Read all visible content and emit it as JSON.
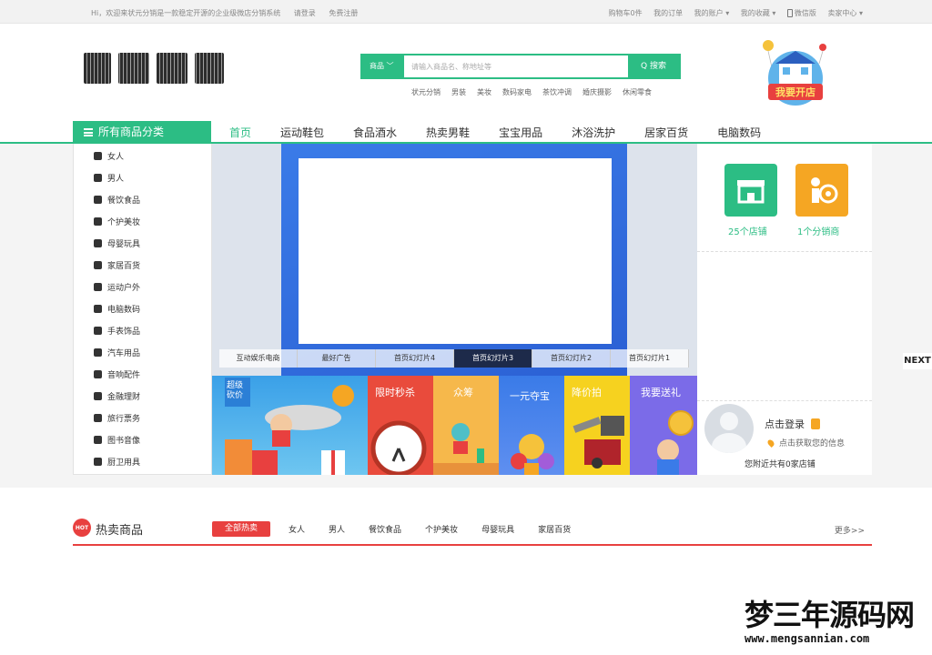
{
  "topbar": {
    "welcome": "Hi，欢迎来状元分销是一款稳定开源的企业级微店分销系统",
    "login": "请登录",
    "register": "免费注册",
    "cart": "购物车0件",
    "orders": "我的订单",
    "account": "我的账户 ▾",
    "favorites": "我的收藏 ▾",
    "wechat": "微信版",
    "seller": "卖家中心 ▾"
  },
  "search": {
    "category": "商品 ﹀",
    "placeholder": "请输入商品名、称地址等",
    "button": "Q 搜索",
    "hotwords": [
      "状元分销",
      "男装",
      "美妆",
      "数码家电",
      "茶饮冲调",
      "婚庆摄影",
      "休闲零食"
    ]
  },
  "badge": {
    "text": "我要开店"
  },
  "nav": {
    "all_categories": "所有商品分类",
    "items": [
      "首页",
      "运动鞋包",
      "食品酒水",
      "热卖男鞋",
      "宝宝用品",
      "沐浴洗护",
      "居家百货",
      "电脑数码"
    ]
  },
  "sidebar": {
    "items": [
      "女人",
      "男人",
      "餐饮食品",
      "个护美妆",
      "母婴玩具",
      "家居百货",
      "运动户外",
      "电脑数码",
      "手表饰品",
      "汽车用品",
      "音响配件",
      "金融理财",
      "旅行票务",
      "图书音像",
      "厨卫用具"
    ]
  },
  "slider": {
    "tabs": [
      "互动娱乐电商",
      "最好广告",
      "首页幻灯片4",
      "首页幻灯片3",
      "首页幻灯片2",
      "首页幻灯片1"
    ],
    "active_tab": "首页幻灯片3",
    "next": "NEXT"
  },
  "right_panel": {
    "stores": "25个店铺",
    "distributors": "1个分销商",
    "login_title": "点击登录",
    "login_hint": "点击获取您的信息",
    "nearby": "您附近共有0家店铺"
  },
  "promos": {
    "super": "超级\n砍价",
    "flash": "限时秒杀",
    "crowd": "众筹",
    "onecoin": "一元夺宝",
    "auction": "降价拍",
    "gift": "我要送礼"
  },
  "hot": {
    "badge": "HOT",
    "title": "热卖商品",
    "all": "全部热卖",
    "cats": [
      "女人",
      "男人",
      "餐饮食品",
      "个护美妆",
      "母婴玩具",
      "家居百货"
    ],
    "more": "更多>>"
  },
  "watermark": {
    "cn": "梦三年源码网",
    "url": "www.mengsannian.com"
  },
  "colors": {
    "accent": "#2cbd84",
    "hot": "#e8403f",
    "slider": "#3a7be8"
  }
}
